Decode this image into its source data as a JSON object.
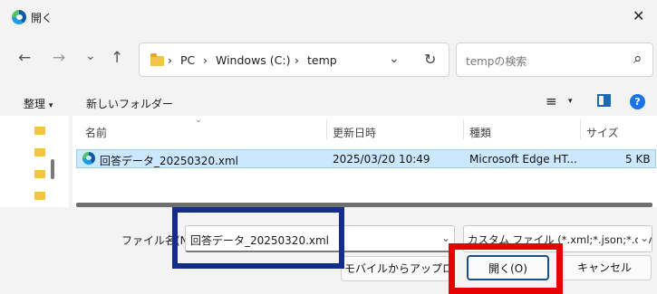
{
  "window": {
    "title": "開く",
    "close_glyph": "✕"
  },
  "nav": {
    "back": "←",
    "forward": "→",
    "recent": "⌄",
    "up": "↑"
  },
  "address": {
    "crumbs": [
      "PC",
      "Windows (C:)",
      "temp"
    ],
    "sep": "›",
    "dropdown": "⌄",
    "refresh": "↻"
  },
  "search": {
    "placeholder": "tempの検索",
    "icon": "⌕"
  },
  "commands": {
    "organize": "整理",
    "organize_caret": "▾",
    "new_folder": "新しいフォルダー",
    "view_glyph": "≡",
    "view_caret": "▾",
    "help": "?"
  },
  "columns": {
    "name": "名前",
    "sort_glyph": "⌄",
    "modified": "更新日時",
    "type": "種類",
    "size": "サイズ"
  },
  "files": [
    {
      "name": "回答データ_20250320.xml",
      "modified": "2025/03/20 10:49",
      "type": "Microsoft Edge HT...",
      "size": "5 KB"
    }
  ],
  "bottom": {
    "filename_label": "ファイル名(N):",
    "filename_value": "回答データ_20250320.xml",
    "filename_caret": "⌄",
    "filetype_value": "カスタム ファイル (*.xml;*.json;*.csv;",
    "filetype_caret": "⌄",
    "upload_button": "モバイルからアップロード",
    "open_button": "開く(O)",
    "cancel_button": "キャンセル"
  },
  "colors": {
    "highlight_blue": "#142d87",
    "highlight_red": "#e60000",
    "selection": "#cce8ff",
    "accent": "#1a73e8"
  }
}
